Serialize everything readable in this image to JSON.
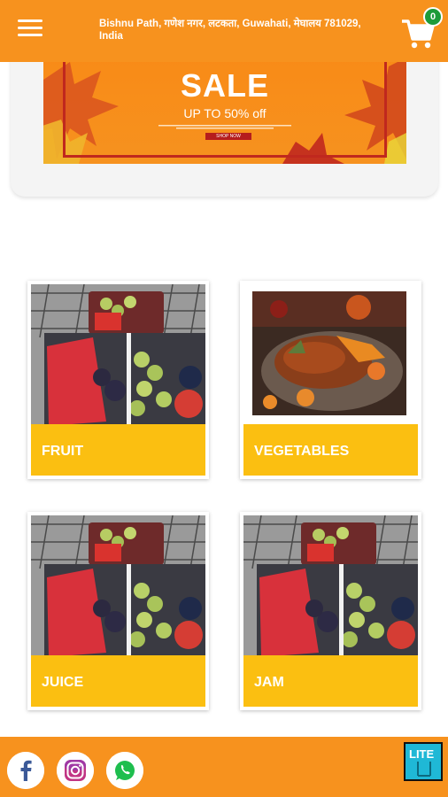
{
  "header": {
    "address": "Bishnu Path, गणेश नगर, लटकता, Guwahati, मेघालय 781029, India",
    "cart_count": "0",
    "bg_color": "#f7921e"
  },
  "banner": {
    "title": "SALE",
    "subtitle": "UP TO 50% off",
    "button_label": "SHOP NOW",
    "accent": "#c0281e"
  },
  "categories": [
    {
      "label": "FRUIT",
      "image": "fruit-platter"
    },
    {
      "label": "VEGETABLES",
      "image": "roast-dish"
    },
    {
      "label": "JUICE",
      "image": "fruit-platter"
    },
    {
      "label": "JAM",
      "image": "fruit-platter"
    }
  ],
  "footer": {
    "icons": [
      "facebook-icon",
      "instagram-icon",
      "whatsapp-icon"
    ],
    "badge": "LITE"
  },
  "colors": {
    "label_bar": "#fbbf11",
    "orange": "#f7921e"
  }
}
